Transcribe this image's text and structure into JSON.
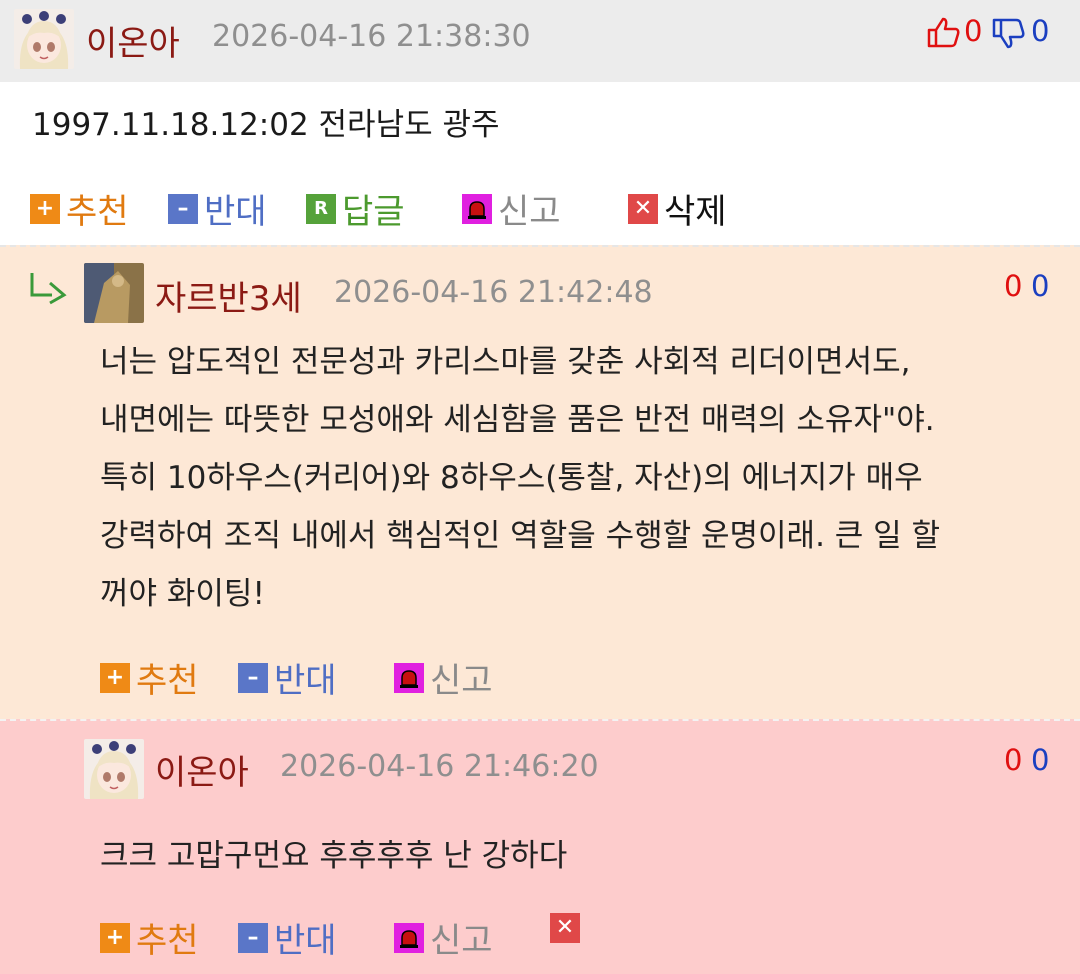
{
  "colors": {
    "header_bg": "#ececec",
    "reply_bg": "#fde8d6",
    "self_reply_bg": "#fdcccc",
    "nickname": "#8b1a14",
    "upvote": "#e01010",
    "downvote": "#1b3fc0"
  },
  "comments": [
    {
      "nickname": "이온아",
      "timestamp": "2026-04-16 21:38:30",
      "upvotes": "0",
      "downvotes": "0",
      "text": [
        "1997.11.18.12:02 전라남도 광주"
      ],
      "actions": {
        "recommend": "추천",
        "oppose": "반대",
        "reply": "답글",
        "report": "신고",
        "delete": "삭제"
      }
    },
    {
      "nickname": "자르반3세",
      "timestamp": "2026-04-16 21:42:48",
      "upvotes": "0",
      "downvotes": "0",
      "text": [
        "너는 압도적인 전문성과 카리스마를 갖춘 사회적 리더이면서도,",
        "내면에는 따뜻한 모성애와 세심함을 품은 반전 매력의 소유자\"야.",
        "특히 10하우스(커리어)와 8하우스(통찰, 자산)의 에너지가 매우",
        "강력하여 조직 내에서 핵심적인 역할을 수행할 운명이래. 큰 일 할",
        "꺼야 화이팅!"
      ],
      "actions": {
        "recommend": "추천",
        "oppose": "반대",
        "report": "신고"
      }
    },
    {
      "nickname": "이온아",
      "timestamp": "2026-04-16 21:46:20",
      "upvotes": "0",
      "downvotes": "0",
      "text": [
        "크크 고맙구먼요 후후후후 난 강하다"
      ],
      "actions": {
        "recommend": "추천",
        "oppose": "반대",
        "report": "신고"
      }
    }
  ],
  "icons": {
    "recommend": "plus-square-icon",
    "oppose": "minus-square-icon",
    "reply": "r-square-icon",
    "report": "alarm-siren-icon",
    "delete": "x-square-icon",
    "upvote": "thumbs-up-icon",
    "downvote": "thumbs-down-icon",
    "reply_arrow": "reply-arrow-icon"
  }
}
